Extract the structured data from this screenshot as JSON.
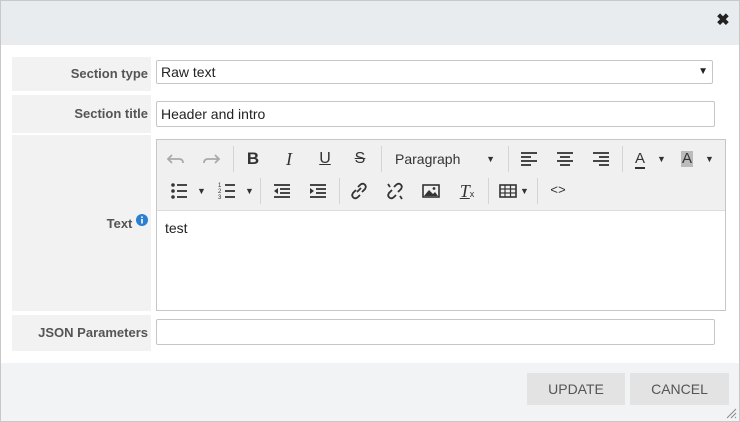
{
  "dialog": {
    "close_icon": "close-icon"
  },
  "form": {
    "section_type": {
      "label": "Section type",
      "value": "Raw text"
    },
    "section_title": {
      "label": "Section title",
      "value": "Header and intro"
    },
    "text": {
      "label": "Text",
      "info_icon": "info-icon",
      "format_select": "Paragraph",
      "content": "test"
    },
    "json_parameters": {
      "label": "JSON Parameters",
      "value": ""
    }
  },
  "toolbar": {
    "row1": [
      "undo-icon",
      "redo-icon",
      "bold-icon",
      "italic-icon",
      "underline-icon",
      "strikethrough-icon",
      "align-left-icon",
      "align-center-icon",
      "align-right-icon",
      "text-color-icon",
      "background-color-icon"
    ],
    "row2": [
      "bullet-list-icon",
      "numbered-list-icon",
      "outdent-icon",
      "indent-icon",
      "link-icon",
      "unlink-icon",
      "image-icon",
      "clear-formatting-icon",
      "table-icon",
      "source-code-icon"
    ]
  },
  "footer": {
    "update_label": "UPDATE",
    "cancel_label": "CANCEL"
  },
  "colors": {
    "titlebar_bg": "#e9ecee",
    "label_bg": "#f2f2f2",
    "toolbar_bg": "#f0f0f0",
    "button_bg": "#e3e3e3",
    "info_blue": "#2b7fd1"
  }
}
